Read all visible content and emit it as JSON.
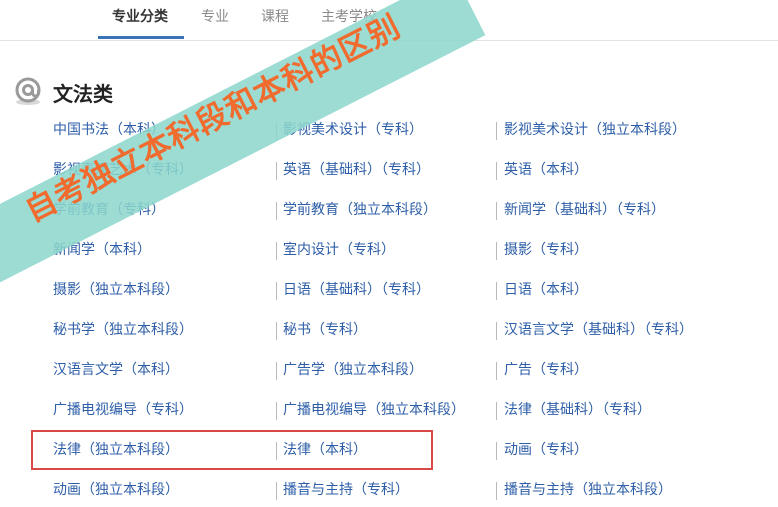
{
  "tabs": [
    {
      "label": "专业分类",
      "active": true
    },
    {
      "label": "专业",
      "active": false
    },
    {
      "label": "课程",
      "active": false
    },
    {
      "label": "主考学校",
      "active": false
    }
  ],
  "section": {
    "title": "文法类",
    "icon": "at-sign-icon"
  },
  "majors": [
    [
      "中国书法（本科）",
      "影视美术设计（专科）",
      "影视美术设计（独立本科段）"
    ],
    [
      "影视表演艺术（专科）",
      "英语（基础科）（专科）",
      "英语（本科）"
    ],
    [
      "学前教育（专科）",
      "学前教育（独立本科段）",
      "新闻学（基础科）（专科）"
    ],
    [
      "新闻学（本科）",
      "室内设计（专科）",
      "摄影（专科）"
    ],
    [
      "摄影（独立本科段）",
      "日语（基础科）（专科）",
      "日语（本科）"
    ],
    [
      "秘书学（独立本科段）",
      "秘书（专科）",
      "汉语言文学（基础科）（专科）"
    ],
    [
      "汉语言文学（本科）",
      "广告学（独立本科段）",
      "广告（专科）"
    ],
    [
      "广播电视编导（专科）",
      "广播电视编导（独立本科段）",
      "法律（基础科）（专科）"
    ],
    [
      "法律（独立本科段）",
      "法律（本科）",
      "动画（专科）"
    ],
    [
      "动画（独立本科段）",
      "播音与主持（专科）",
      "播音与主持（独立本科段）"
    ]
  ],
  "overlay": {
    "text": "自考独立本科段和本科的区别"
  },
  "colors": {
    "link": "#2d5ea7",
    "accent": "#3a73b5",
    "highlight": "#d94747",
    "banner": "#8cd6cc",
    "banner_text": "#f06b2d"
  }
}
